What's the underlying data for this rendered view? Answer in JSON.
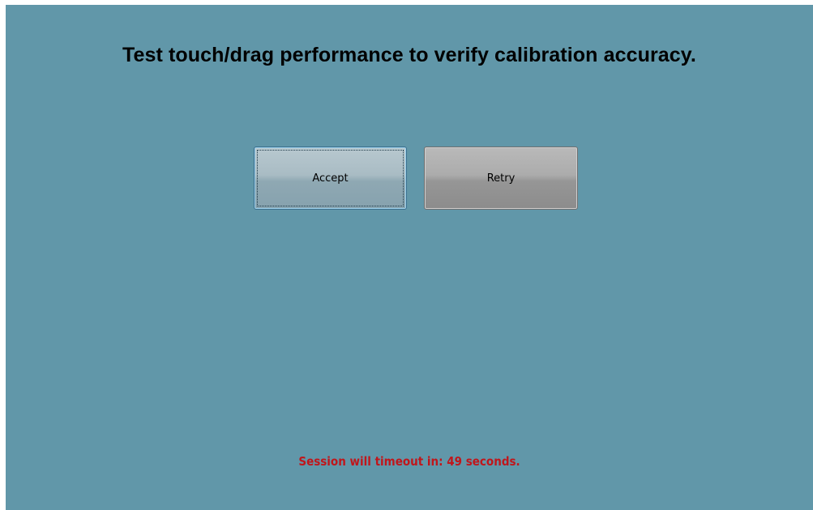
{
  "window": {
    "background_color": "#6197a9"
  },
  "main": {
    "title": "Test touch/drag performance to verify calibration accuracy."
  },
  "buttons": {
    "accept_label": "Accept",
    "retry_label": "Retry"
  },
  "status": {
    "timeout_text": "Session will timeout in: 49 seconds.",
    "timeout_color": "#c0161b"
  }
}
